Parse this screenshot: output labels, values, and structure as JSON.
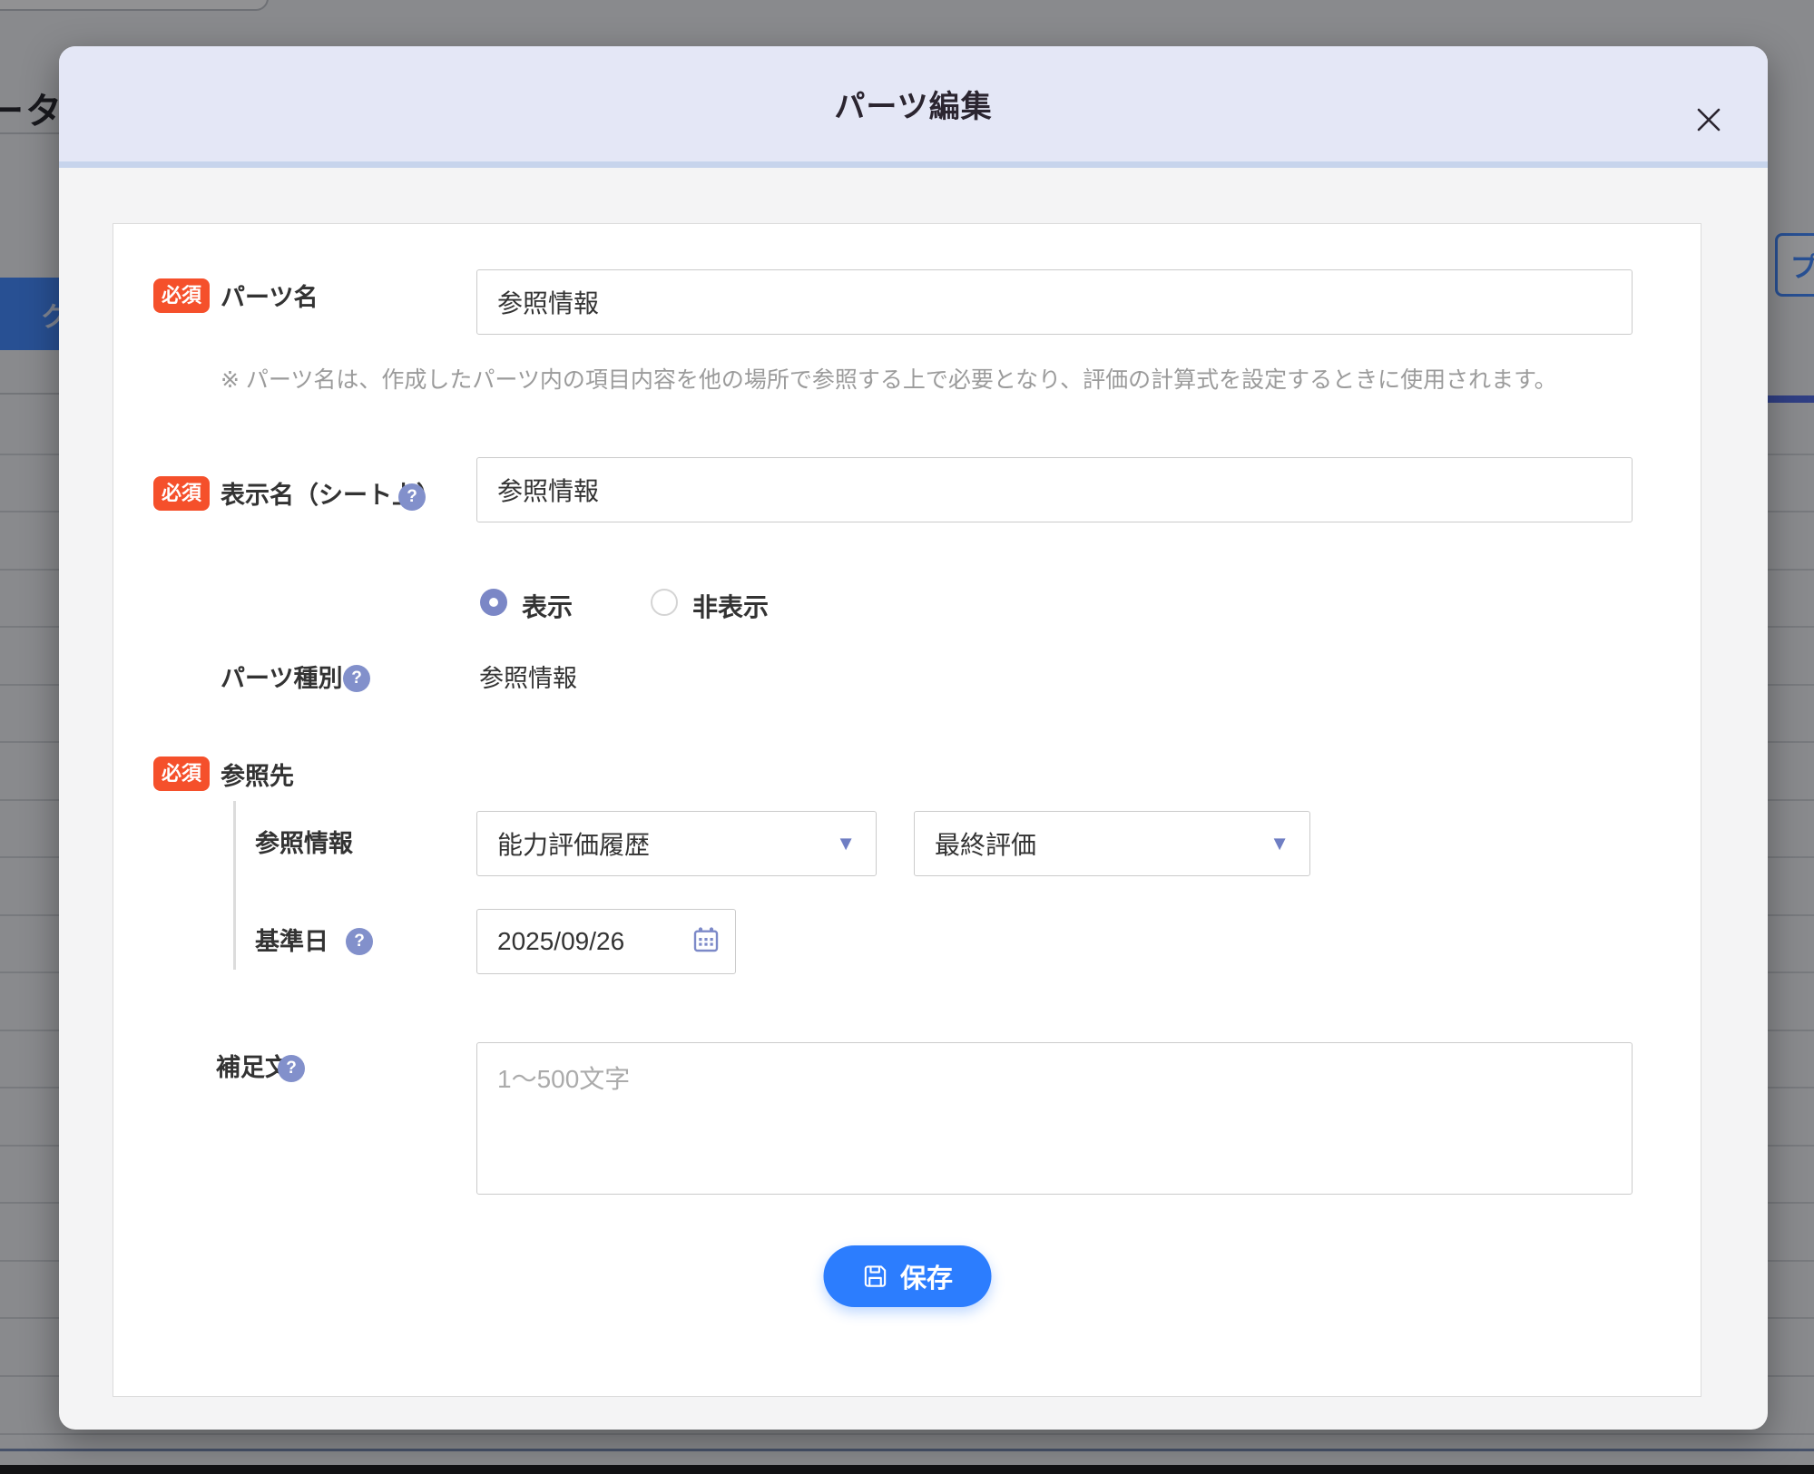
{
  "background": {
    "partial_text_left": "ータ",
    "left_button_label": "グ設定",
    "right_button_label": "プ"
  },
  "modal": {
    "title": "パーツ編集",
    "form": {
      "required_badge": "必須",
      "parts_name": {
        "label": "パーツ名",
        "value": "参照情報",
        "note": "※ パーツ名は、作成したパーツ内の項目内容を他の場所で参照する上で必要となり、評価の計算式を設定するときに使用されます。"
      },
      "display_name": {
        "label": "表示名（シート上）",
        "value": "参照情報"
      },
      "visibility": {
        "options": [
          {
            "label": "表示",
            "selected": true
          },
          {
            "label": "非表示",
            "selected": false
          }
        ]
      },
      "parts_type": {
        "label": "パーツ種別",
        "value": "参照情報"
      },
      "reference": {
        "label": "参照先",
        "row_label": "参照情報",
        "source_selected": "能力評価履歴",
        "item_selected": "最終評価"
      },
      "base_date": {
        "label": "基準日",
        "value": "2025/09/26"
      },
      "supplement": {
        "label": "補足文",
        "placeholder": "1〜500文字"
      },
      "save_label": "保存"
    },
    "icons": {
      "close": "✕",
      "help": "?",
      "dropdown_caret": "▼",
      "save": "floppy-disk",
      "calendar": "calendar"
    },
    "colors": {
      "required_badge_bg": "#F5502B",
      "help_icon_bg": "#8290CB",
      "radio_selected": "#7B87C6",
      "accent_blue": "#2C7DFE",
      "header_bg": "#E4E7F6",
      "header_border": "#C7D4EC"
    }
  }
}
